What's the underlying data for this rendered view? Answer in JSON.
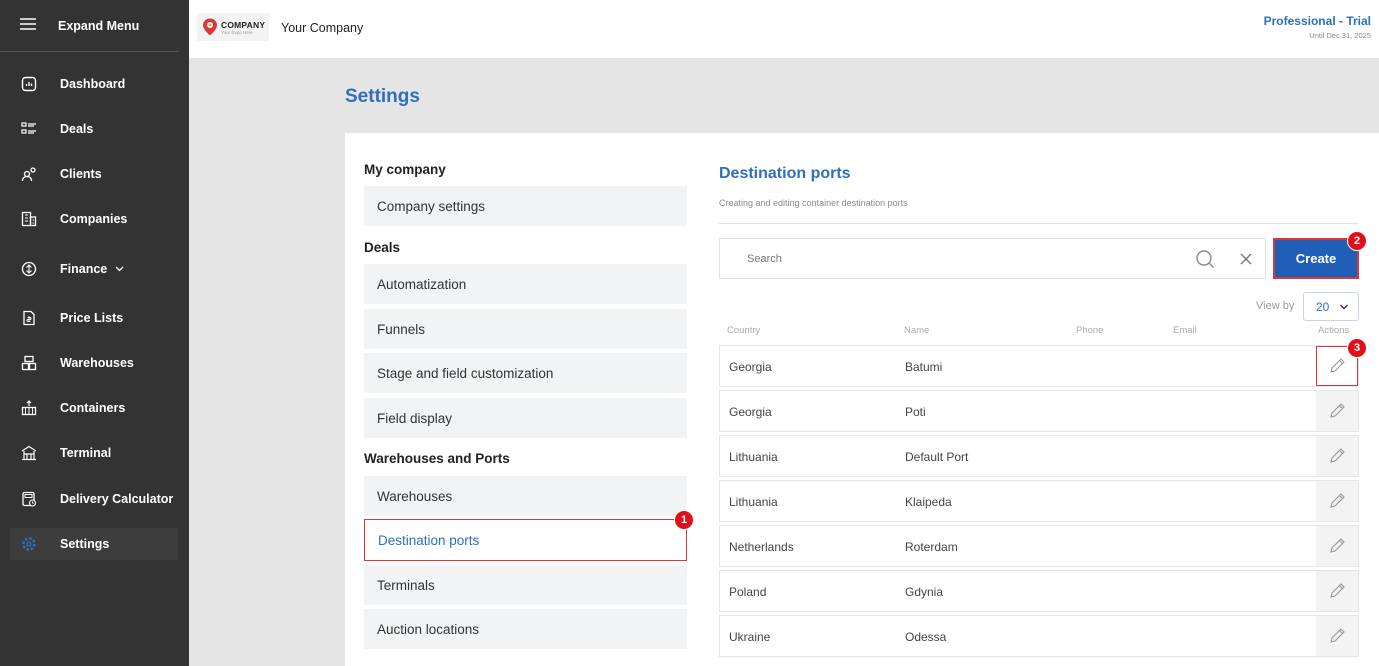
{
  "sidebar": {
    "expand_label": "Expand Menu",
    "items": [
      {
        "label": "Dashboard",
        "icon": "dashboard-icon"
      },
      {
        "label": "Deals",
        "icon": "deals-icon"
      },
      {
        "label": "Clients",
        "icon": "clients-icon"
      },
      {
        "label": "Companies",
        "icon": "companies-icon"
      },
      {
        "label": "Finance",
        "icon": "finance-icon"
      },
      {
        "label": "Price Lists",
        "icon": "price-list-icon"
      },
      {
        "label": "Warehouses",
        "icon": "warehouse-icon"
      },
      {
        "label": "Containers",
        "icon": "containers-icon"
      },
      {
        "label": "Terminal",
        "icon": "terminal-icon"
      },
      {
        "label": "Delivery Calculator",
        "icon": "calculator-icon"
      },
      {
        "label": "Settings",
        "icon": "gear-icon"
      }
    ]
  },
  "header": {
    "logo_main": "COMPANY",
    "logo_sub": "Your Expo Here",
    "company_name": "Your Company",
    "plan_title": "Professional - Trial",
    "plan_until": "Until Dec 31, 2025"
  },
  "page": {
    "title": "Settings"
  },
  "settings_menu": {
    "section_company": "My company",
    "company_settings": "Company settings",
    "section_deals": "Deals",
    "automatization": "Automatization",
    "funnels": "Funnels",
    "stage_field": "Stage and field customization",
    "field_display": "Field display",
    "section_wh": "Warehouses and Ports",
    "warehouses": "Warehouses",
    "destination_ports": "Destination ports",
    "terminals": "Terminals",
    "auction_locations": "Auction locations"
  },
  "content": {
    "title": "Destination ports",
    "subtitle": "Creating and editing container destination ports",
    "search_placeholder": "Search",
    "create_label": "Create",
    "view_by_label": "View by",
    "view_by_value": "20",
    "columns": {
      "country": "Country",
      "name": "Name",
      "phone": "Phone",
      "email": "Email",
      "actions": "Actions"
    },
    "rows": [
      {
        "country": "Georgia",
        "name": "Batumi"
      },
      {
        "country": "Georgia",
        "name": "Poti"
      },
      {
        "country": "Lithuania",
        "name": "Default Port"
      },
      {
        "country": "Lithuania",
        "name": "Klaipeda"
      },
      {
        "country": "Netherlands",
        "name": "Roterdam"
      },
      {
        "country": "Poland",
        "name": "Gdynia"
      },
      {
        "country": "Ukraine",
        "name": "Odessa"
      }
    ]
  },
  "badges": {
    "b1": "1",
    "b2": "2",
    "b3": "3"
  },
  "colors": {
    "accent": "#2e6fbf",
    "button": "#1f5fb8",
    "highlight": "#d9373c",
    "sidebar": "#333333"
  }
}
